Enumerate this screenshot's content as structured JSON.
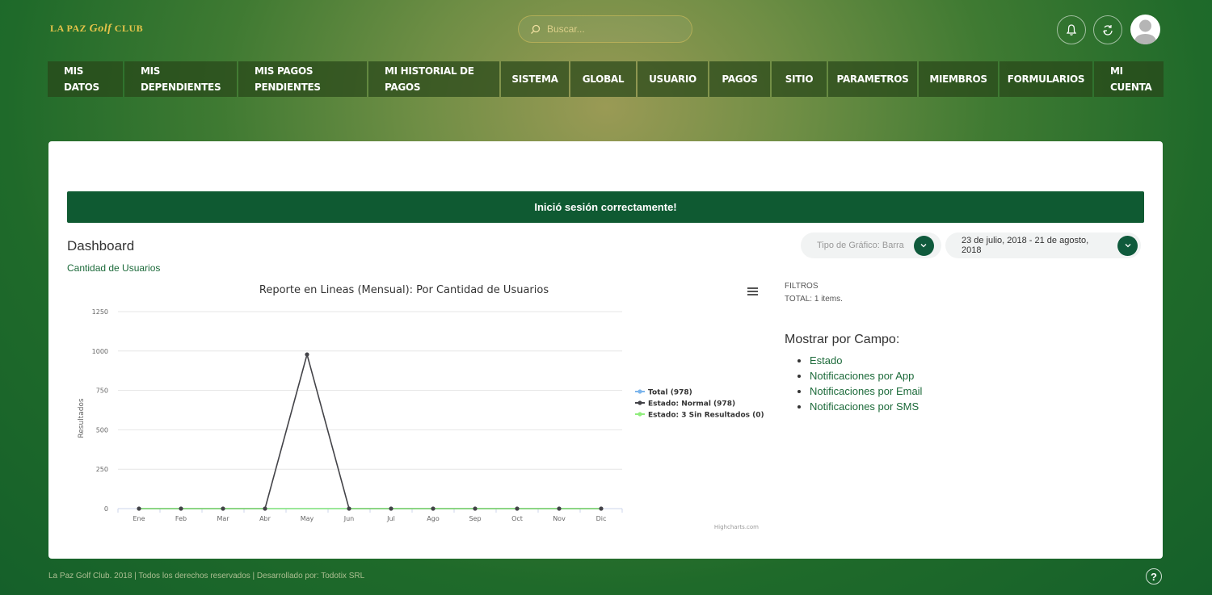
{
  "header": {
    "logo": {
      "pre": "LA PAZ ",
      "script": "Golf",
      "post": " CLUB"
    },
    "search": {
      "placeholder": "Buscar..."
    },
    "icons": [
      "bell-icon",
      "refresh-icon",
      "user-avatar"
    ]
  },
  "nav": [
    {
      "label": "MIS\nDATOS",
      "name": "nav-mis-datos"
    },
    {
      "label": "MIS\nDEPENDIENTES",
      "name": "nav-mis-dependientes"
    },
    {
      "label": "MIS PAGOS\nPENDIENTES",
      "name": "nav-mis-pagos-pendientes"
    },
    {
      "label": "MI HISTORIAL DE\nPAGOS",
      "name": "nav-mi-historial-de-pagos"
    },
    {
      "label": "SISTEMA",
      "name": "nav-sistema"
    },
    {
      "label": "GLOBAL",
      "name": "nav-global"
    },
    {
      "label": "USUARIO",
      "name": "nav-usuario"
    },
    {
      "label": "PAGOS",
      "name": "nav-pagos"
    },
    {
      "label": "SITIO",
      "name": "nav-sitio"
    },
    {
      "label": "PARAMETROS",
      "name": "nav-parametros"
    },
    {
      "label": "MIEMBROS",
      "name": "nav-miembros"
    },
    {
      "label": "FORMULARIOS",
      "name": "nav-formularios"
    },
    {
      "label": "MI\nCUENTA",
      "name": "nav-mi-cuenta"
    }
  ],
  "alert": {
    "message": "Inició sesión correctamente!"
  },
  "dashboard": {
    "title": "Dashboard",
    "subtitle": "Cantidad de Usuarios",
    "chart_type_selector": "Tipo de Gráfico: Barra",
    "date_range_selector": "23 de julio, 2018 - 21 de agosto, 2018"
  },
  "chart_data": {
    "type": "line",
    "title": "Reporte en Lineas (Mensual): Por Cantidad de Usuarios",
    "xlabel": "",
    "ylabel": "Resultados",
    "categories": [
      "Ene",
      "Feb",
      "Mar",
      "Abr",
      "May",
      "Jun",
      "Jul",
      "Ago",
      "Sep",
      "Oct",
      "Nov",
      "Dic"
    ],
    "ylim": [
      0,
      1250
    ],
    "yticks": [
      0,
      250,
      500,
      750,
      1000,
      1250
    ],
    "grid": true,
    "legend_position": "right",
    "series": [
      {
        "name": "Total (978)",
        "color": "#7cb5ec",
        "values": [
          0,
          0,
          0,
          0,
          0,
          0,
          0,
          0,
          0,
          0,
          0,
          0
        ]
      },
      {
        "name": "Estado: Normal (978)",
        "color": "#434348",
        "values": [
          0,
          0,
          0,
          0,
          978,
          0,
          0,
          0,
          0,
          0,
          0,
          0
        ]
      },
      {
        "name": "Estado: 3 Sin Resultados (0)",
        "color": "#90ed7d",
        "values": [
          0,
          0,
          0,
          0,
          0,
          0,
          0,
          0,
          0,
          0,
          0,
          0
        ]
      }
    ],
    "credits": "Highcharts.com"
  },
  "filters": {
    "title": "FILTROS",
    "total": "TOTAL: 1 items."
  },
  "fields": {
    "title": "Mostrar por Campo:",
    "items": [
      "Estado",
      "Notificaciones por App",
      "Notificaciones por Email",
      "Notificaciones por SMS"
    ]
  },
  "footer": {
    "text": "La Paz Golf Club. 2018 | Todos los derechos reservados | Desarrollado por: Todotix SRL"
  },
  "colors": {
    "brand_green": "#0f5a32",
    "accent_gold": "#e6c44a"
  }
}
